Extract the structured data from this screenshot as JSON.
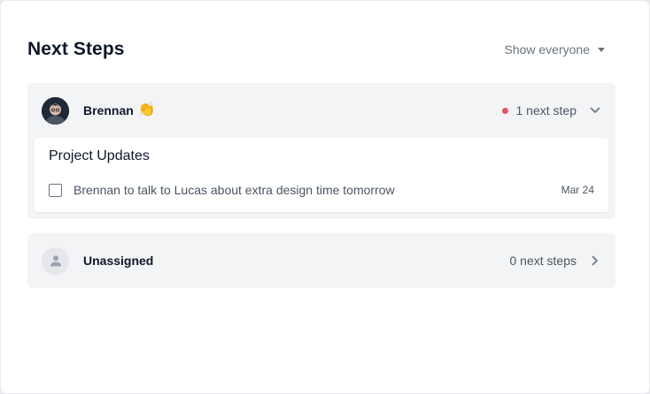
{
  "header": {
    "title": "Next Steps",
    "filter_label": "Show everyone"
  },
  "people": [
    {
      "name": "Brennan",
      "emoji": "👏",
      "count_label": "1 next step",
      "status_color": "#e5566b",
      "expanded": true,
      "project": {
        "title": "Project Updates",
        "tasks": [
          {
            "text": "Brennan to talk to Lucas about extra design time tomorrow",
            "date": "Mar 24",
            "done": false
          }
        ]
      }
    },
    {
      "name": "Unassigned",
      "count_label": "0 next steps",
      "expanded": false
    }
  ],
  "icons": {
    "filter": "caret-down-icon",
    "expanded": "chevron-down-icon",
    "collapsed": "chevron-right-icon",
    "avatar_placeholder": "person-icon"
  }
}
